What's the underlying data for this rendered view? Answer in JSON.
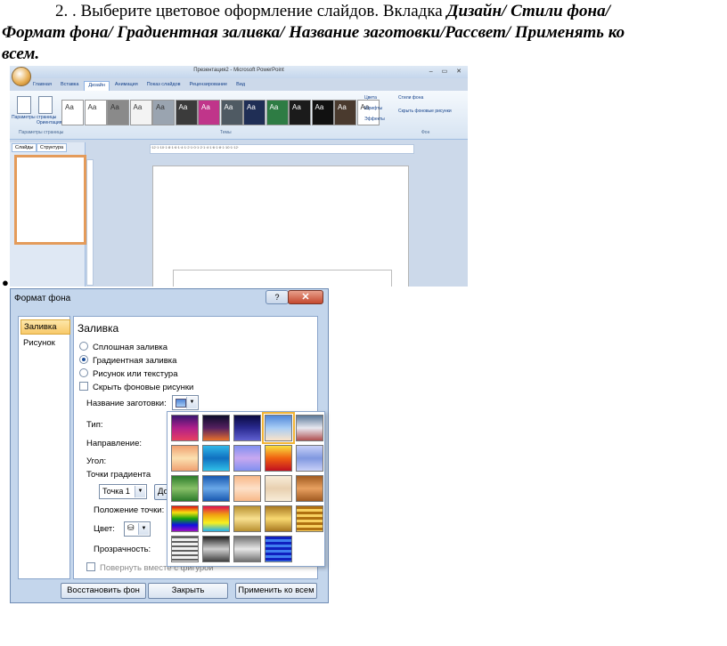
{
  "instruction": {
    "number": "2.",
    "text_plain": ". Выберите цветовое оформление слайдов. Вкладка",
    "path_line1": "Дизайн/ Стили фона/",
    "path_line2": "Формат фона/ Градиентная заливка/ Название заготовки/Рассвет/ Применять ко",
    "path_line3": "всем."
  },
  "bullet": "●",
  "powerpoint": {
    "title": "Презентация2 - Microsoft PowerPoint",
    "window_buttons": "– ▭ ✕",
    "tabs": [
      "Главная",
      "Вставка",
      "Дизайн",
      "Анимация",
      "Показ слайдов",
      "Рецензирование",
      "Вид"
    ],
    "active_tab": "Дизайн",
    "page_setup_labels": [
      "Параметры страницы",
      "Ориентация слайда"
    ],
    "group_page_setup": "Параметры страницы",
    "group_themes": "Темы",
    "group_background": "Фон",
    "theme_thumb_text": "Aa",
    "themes_buttons": [
      "Цвета",
      "Шрифты",
      "Эффекты"
    ],
    "background_buttons": [
      "Стили фона",
      "Скрыть фоновые рисунки"
    ],
    "panel_tabs": [
      "Слайды",
      "Структура"
    ],
    "ruler": "·12·1·10·1·8·1·6·1·4·1·2·1·0·1·2·1·4·1·6·1·8·1·10·1·12·",
    "theme_colors": [
      "#ffffff",
      "#ffffff",
      "#8a8a8a",
      "#f3f3f3",
      "#9aa4b0",
      "#3b3b3b",
      "#c0358a",
      "#4f5a63",
      "#1f2e55",
      "#2e7c44",
      "#1b1b1b",
      "#111111",
      "#4a3a2e",
      "#ffffff"
    ]
  },
  "dialog": {
    "title": "Формат фона",
    "help_button": "?",
    "close_button": "✕",
    "nav": [
      "Заливка",
      "Рисунок"
    ],
    "section_title": "Заливка",
    "fill_options": [
      {
        "label": "Сплошная заливка",
        "checked": false
      },
      {
        "label": "Градиентная заливка",
        "checked": true
      },
      {
        "label": "Рисунок или текстура",
        "checked": false
      }
    ],
    "hide_bg_label": "Скрыть фоновые рисунки",
    "preset_label": "Название заготовки:",
    "type_label": "Тип:",
    "direction_label": "Направление:",
    "angle_label": "Угол:",
    "stops_label": "Точки градиента",
    "stop_value": "Точка 1",
    "add_button_partial": "До",
    "position_label": "Положение точки:",
    "color_label": "Цвет:",
    "transparency_label": "Прозрачность:",
    "rotate_label": "Повернуть вместе с фигурой",
    "buttons": {
      "reset": "Восстановить фон",
      "close": "Закрыть",
      "apply_all": "Применить ко всем"
    }
  },
  "gallery": {
    "selected_index": 3,
    "presets": [
      "linear-gradient(#3a1570,#b0208a,#e84060)",
      "linear-gradient(#0c0c2a,#552060,#e8702a)",
      "linear-gradient(#0a0a40,#2a2a90,#6060d0)",
      "linear-gradient(#4f86d8,#a8cdf5,#fbe3c8)",
      "linear-gradient(#5a7898,#e8e8f0,#b05050)",
      "linear-gradient(#f0a070,#fbe0b0,#f0a070)",
      "linear-gradient(#30b8e8,#1070c0,#30c0e8)",
      "linear-gradient(#8090f0,#c8a8f0,#8090f0)",
      "linear-gradient(#f8e040,#f06010,#c01020)",
      "linear-gradient(#c8d0f8,#8098e0,#c8d0f8)",
      "linear-gradient(#2a7a2a,#88c068,#2a7a2a)",
      "linear-gradient(#1858b0,#6aa8e8,#1858b0)",
      "linear-gradient(#f8b888,#fde0c8,#f8b888)",
      "linear-gradient(#f8ecd8,#e8d0b0,#f8ecd8)",
      "linear-gradient(#a05a20,#e8a060,#a05a20)",
      "linear-gradient(#e01010,#f8e010,#10a010,#1010e0,#a010c0)",
      "linear-gradient(#e01050,#f0a010,#f8f020,#20b0f0)",
      "linear-gradient(#b89030,#f8e090,#b89030)",
      "linear-gradient(#a87820,#f8d870,#a87820)",
      "repeating-linear-gradient(#b07010 0 3px,#f8d060 3px 6px)",
      "repeating-linear-gradient(#606060 0 2px,#f0f0f0 2px 5px)",
      "linear-gradient(#202020,#d0d0d0,#404040)",
      "linear-gradient(#707070,#e8e8e8,#707070)",
      "repeating-linear-gradient(#1020c0 0 3px,#4080f0 3px 6px)"
    ]
  }
}
